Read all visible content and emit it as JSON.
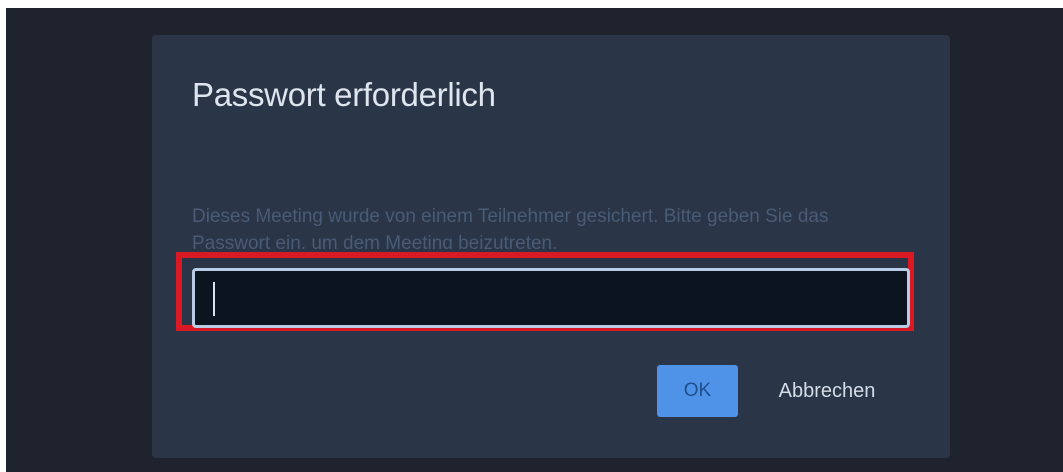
{
  "dialog": {
    "title": "Passwort erforderlich",
    "message": "Dieses Meeting wurde von einem Teilnehmer gesichert. Bitte geben Sie das Passwort ein, um dem Meeting beizutreten.",
    "password_value": "",
    "ok_label": "OK",
    "cancel_label": "Abbrechen"
  },
  "colors": {
    "backdrop": "#1e232e",
    "dialog_background": "#2a3547",
    "accent": "#4f93e8",
    "highlight": "#d91a24"
  }
}
